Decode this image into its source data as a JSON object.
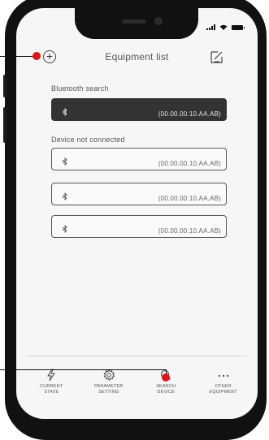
{
  "header": {
    "title": "Equipment list"
  },
  "sections": {
    "bluetooth_label": "Bluetooth search",
    "disconnected_label": "Device not connected"
  },
  "devices": {
    "active": {
      "address": "(00.00.00.10.AA.AB)"
    },
    "list": [
      {
        "address": "(00.00.00.10.AA.AB)"
      },
      {
        "address": "(00.00.00.10.AA.AB)"
      },
      {
        "address": "(00.00.00.10.AA.AB)"
      }
    ]
  },
  "tabs": [
    {
      "label_line1": "CURRENT",
      "label_line2": "STATE",
      "icon": "lightning-icon"
    },
    {
      "label_line1": "PARAMETER",
      "label_line2": "SETTING",
      "icon": "gear-icon"
    },
    {
      "label_line1": "SEARCH",
      "label_line2": "DEVICE",
      "icon": "search-icon"
    },
    {
      "label_line1": "OTHER",
      "label_line2": "EQUIPMENT",
      "icon": "more-dots-icon"
    }
  ],
  "colors": {
    "callout": "#e0141a",
    "active_device": "#333333"
  }
}
